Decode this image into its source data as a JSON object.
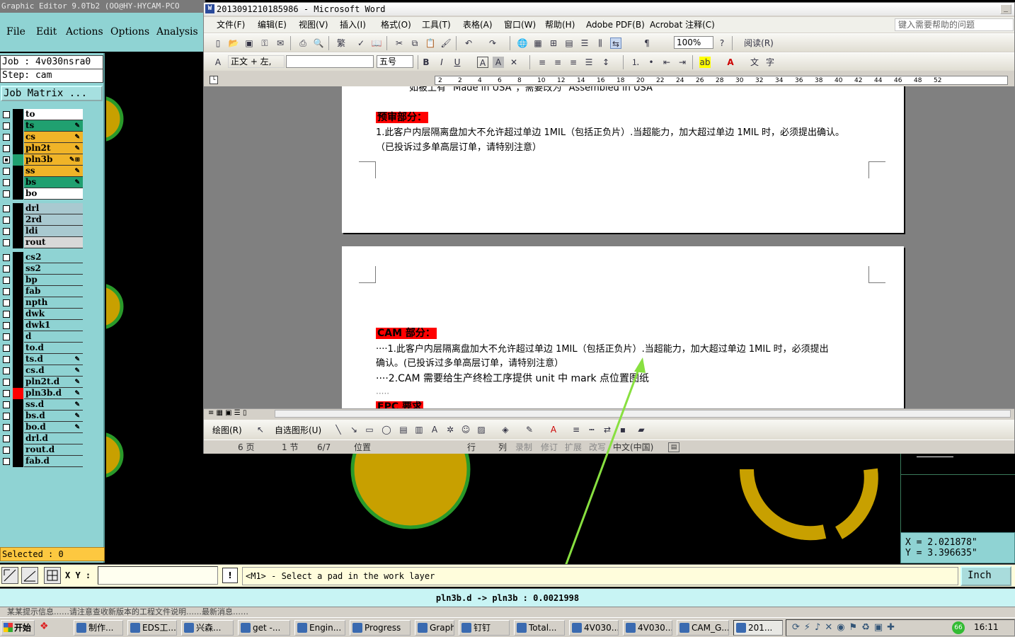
{
  "genesis": {
    "title": "Graphic Editor 9.0Tb2 (OO@HY-HYCAM-PCO",
    "menu": [
      "File",
      "Edit",
      "Actions",
      "Options",
      "Analysis"
    ],
    "job_label": "Job : 4v030nsra0",
    "step_label": "Step: cam",
    "job_matrix_label": "Job Matrix ...",
    "layers_board": [
      {
        "name": "to",
        "color": "#ffffff",
        "checked": false,
        "edit": ""
      },
      {
        "name": "ts",
        "color": "#20a070",
        "checked": false,
        "edit": "✎"
      },
      {
        "name": "cs",
        "color": "#f0b428",
        "checked": false,
        "edit": "✎"
      },
      {
        "name": "pln2t",
        "color": "#f0b428",
        "checked": false,
        "edit": "✎"
      },
      {
        "name": "pln3b",
        "color": "#f0b428",
        "checked": true,
        "edit": "✎⊞"
      },
      {
        "name": "ss",
        "color": "#f0b428",
        "checked": false,
        "edit": "✎"
      },
      {
        "name": "bs",
        "color": "#20a070",
        "checked": false,
        "edit": "✎"
      },
      {
        "name": "bo",
        "color": "#ffffff",
        "checked": false,
        "edit": ""
      }
    ],
    "layers_drill": [
      {
        "name": "drl",
        "color": "#a9c9d0"
      },
      {
        "name": "2rd",
        "color": "#a9c9d0"
      },
      {
        "name": "ldi",
        "color": "#a9c9d0"
      },
      {
        "name": "rout",
        "color": "#d8d8d8"
      }
    ],
    "layers_misc": [
      {
        "name": "cs2",
        "edit": ""
      },
      {
        "name": "ss2",
        "edit": ""
      },
      {
        "name": "bp",
        "edit": ""
      },
      {
        "name": "fab",
        "edit": ""
      },
      {
        "name": "npth",
        "edit": ""
      },
      {
        "name": "dwk",
        "edit": ""
      },
      {
        "name": "dwk1",
        "edit": ""
      },
      {
        "name": "d",
        "edit": ""
      },
      {
        "name": "to.d",
        "edit": ""
      },
      {
        "name": "ts.d",
        "edit": "✎"
      },
      {
        "name": "cs.d",
        "edit": "✎"
      },
      {
        "name": "pln2t.d",
        "edit": "✎"
      },
      {
        "name": "pln3b.d",
        "edit": "✎",
        "swatch": "#ff0000"
      },
      {
        "name": "ss.d",
        "edit": "✎"
      },
      {
        "name": "bs.d",
        "edit": "✎"
      },
      {
        "name": "bo.d",
        "edit": "✎"
      },
      {
        "name": "drl.d",
        "edit": ""
      },
      {
        "name": "rout.d",
        "edit": ""
      },
      {
        "name": "fab.d",
        "edit": ""
      }
    ],
    "selected_label": "Selected : 0",
    "coords": {
      "x": "X = 2.021878\"",
      "y": "Y = 3.396635\""
    },
    "xy_label": "X Y :",
    "xy_value": "",
    "bang": "!",
    "prompt": "<M1> - Select a pad in the work layer",
    "unit": "Inch",
    "status_line": "pln3b.d -> pln3b : 0.0021998",
    "pad_color": "#c8a000",
    "pad_ring_color": "#2a9a2a"
  },
  "word": {
    "title": "2013091210185986 - Microsoft Word",
    "menu": [
      "文件(F)",
      "编辑(E)",
      "视图(V)",
      "插入(I)",
      "格式(O)",
      "工具(T)",
      "表格(A)",
      "窗口(W)",
      "帮助(H)",
      "Adobe PDF(B)",
      "Acrobat 注释(C)"
    ],
    "help_placeholder": "键入需要帮助的问题",
    "zoom": "100%",
    "read_btn": "阅读(R)",
    "style_combo": "正文 + 左,",
    "font_combo": "",
    "size_combo": "五号",
    "ruler_ticks": [
      "2",
      "2",
      "4",
      "6",
      "8",
      "10",
      "12",
      "14",
      "16",
      "18",
      "20",
      "22",
      "24",
      "26",
      "28",
      "30",
      "32",
      "34",
      "36",
      "38",
      "40",
      "42",
      "44",
      "46",
      "48",
      "52"
    ],
    "page1": {
      "top_line": "如被上有 \"Made in USA\"，需要改为 \"Assembled in USA\"",
      "heading": "预审部分：",
      "line1": "1.此客户内层隔离盘加大不允许超过单边 1MIL（包括正负片）.当超能力，加大超过单边 1MIL 时，必须提出确认。",
      "line2": "（已投诉过多单高层订单，请特别注意）"
    },
    "page2": {
      "heading": "CAM 部分：",
      "line1": "····1.此客户内层隔离盘加大不允许超过单边 1MIL（包括正负片）.当超能力，加大超过单边 1MIL 时，必须提出",
      "line2": "确认。(已投诉过多单高层订单，请特别注意）",
      "line3": "····2.CAM 需要给生产终检工序提供 unit 中 mark 点位置图纸",
      "line4": "·····",
      "next_heading": "EPC 要求"
    },
    "drawbar": {
      "draw": "绘图(R)",
      "autoshape": "自选图形(U)"
    },
    "status": {
      "page": "6 页",
      "section": "1 节",
      "pos": "6/7",
      "at": "位置",
      "ln": "行",
      "col": "列",
      "rec": "录制",
      "trk": "修订",
      "ext": "扩展",
      "ovr": "改写",
      "lang": "中文(中国)"
    }
  },
  "taskbar": {
    "start": "开始",
    "items": [
      "制作...",
      "EDS工...",
      "兴森...",
      "get -...",
      "Engin...",
      "Progress",
      "Graph...",
      "钉钉",
      "Total...",
      "4V030...",
      "4V030...",
      "CAM_G...",
      "201..."
    ],
    "clock": "16:11",
    "strip_text": "某某提示信息……请注意查收新版本的工程文件说明……最新消息……"
  }
}
